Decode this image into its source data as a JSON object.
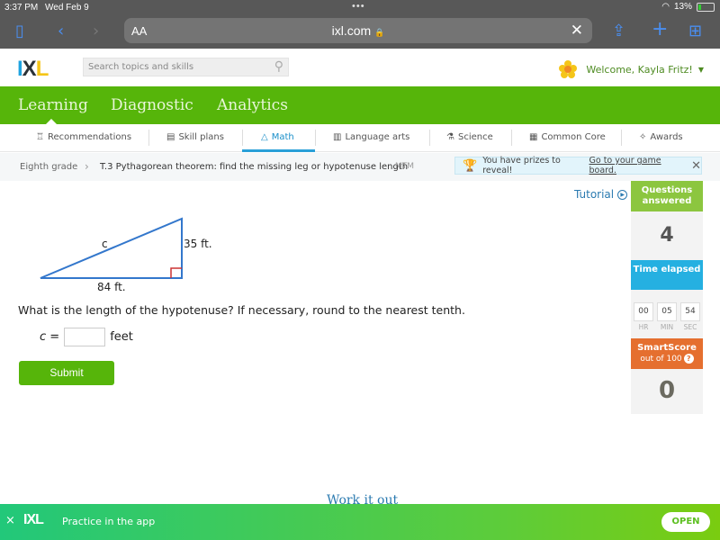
{
  "status": {
    "time": "3:37 PM",
    "date": "Wed Feb 9",
    "battery": "13%"
  },
  "browser": {
    "text_size": "AA",
    "url": "ixl.com",
    "lock": "🔒"
  },
  "header": {
    "search_placeholder": "Search topics and skills",
    "welcome": "Welcome, Kayla Fritz!"
  },
  "main_tabs": [
    "Learning",
    "Diagnostic",
    "Analytics"
  ],
  "subnav": [
    {
      "label": "Recommendations",
      "icon": "recommendations-icon"
    },
    {
      "label": "Skill plans",
      "icon": "skill-plans-icon"
    },
    {
      "label": "Math",
      "icon": "math-pyramid-icon",
      "active": true
    },
    {
      "label": "Language arts",
      "icon": "book-icon"
    },
    {
      "label": "Science",
      "icon": "flask-icon"
    },
    {
      "label": "Common Core",
      "icon": "clipboard-icon"
    },
    {
      "label": "Awards",
      "icon": "awards-icon"
    }
  ],
  "breadcrumb": {
    "grade": "Eighth grade",
    "skill": "T.3 Pythagorean theorem: find the missing leg or hypotenuse length",
    "tag": "MTM"
  },
  "prize": {
    "text": "You have prizes to reveal!",
    "link": "Go to your game board."
  },
  "tutorial": "Tutorial",
  "stats": {
    "questions_label": "Questions answered",
    "questions_value": "4",
    "time_label": "Time elapsed",
    "time": {
      "hr": "00",
      "min": "05",
      "sec": "54",
      "hr_label": "HR",
      "min_label": "MIN",
      "sec_label": "SEC"
    },
    "smartscore_label": "SmartScore",
    "smartscore_sub": "out of 100",
    "smartscore_value": "0"
  },
  "figure": {
    "hyp_label": "c",
    "vertical_label": "35 ft.",
    "base_label": "84 ft."
  },
  "question": {
    "text": "What is the length of the hypotenuse? If necessary, round to the nearest tenth.",
    "var": "c =",
    "value": "",
    "unit": "feet",
    "submit": "Submit"
  },
  "work_it_out": "Work it out",
  "appbar": {
    "close": "×",
    "logo": "IXL",
    "text": "Practice in the app",
    "open": "OPEN"
  }
}
